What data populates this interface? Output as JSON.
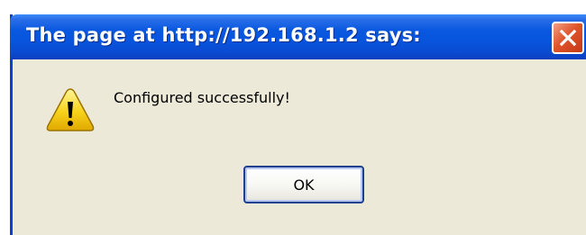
{
  "dialog": {
    "title": "The page at http://192.168.1.2 says:",
    "message": "Configured successfully!",
    "ok_label": "OK",
    "icon": "warning-icon",
    "close_icon": "close-icon"
  },
  "colors": {
    "titlebar": "#0a58e0",
    "body": "#ece9d8",
    "close_button": "#e0542b",
    "warning_yellow": "#f7d21a"
  }
}
